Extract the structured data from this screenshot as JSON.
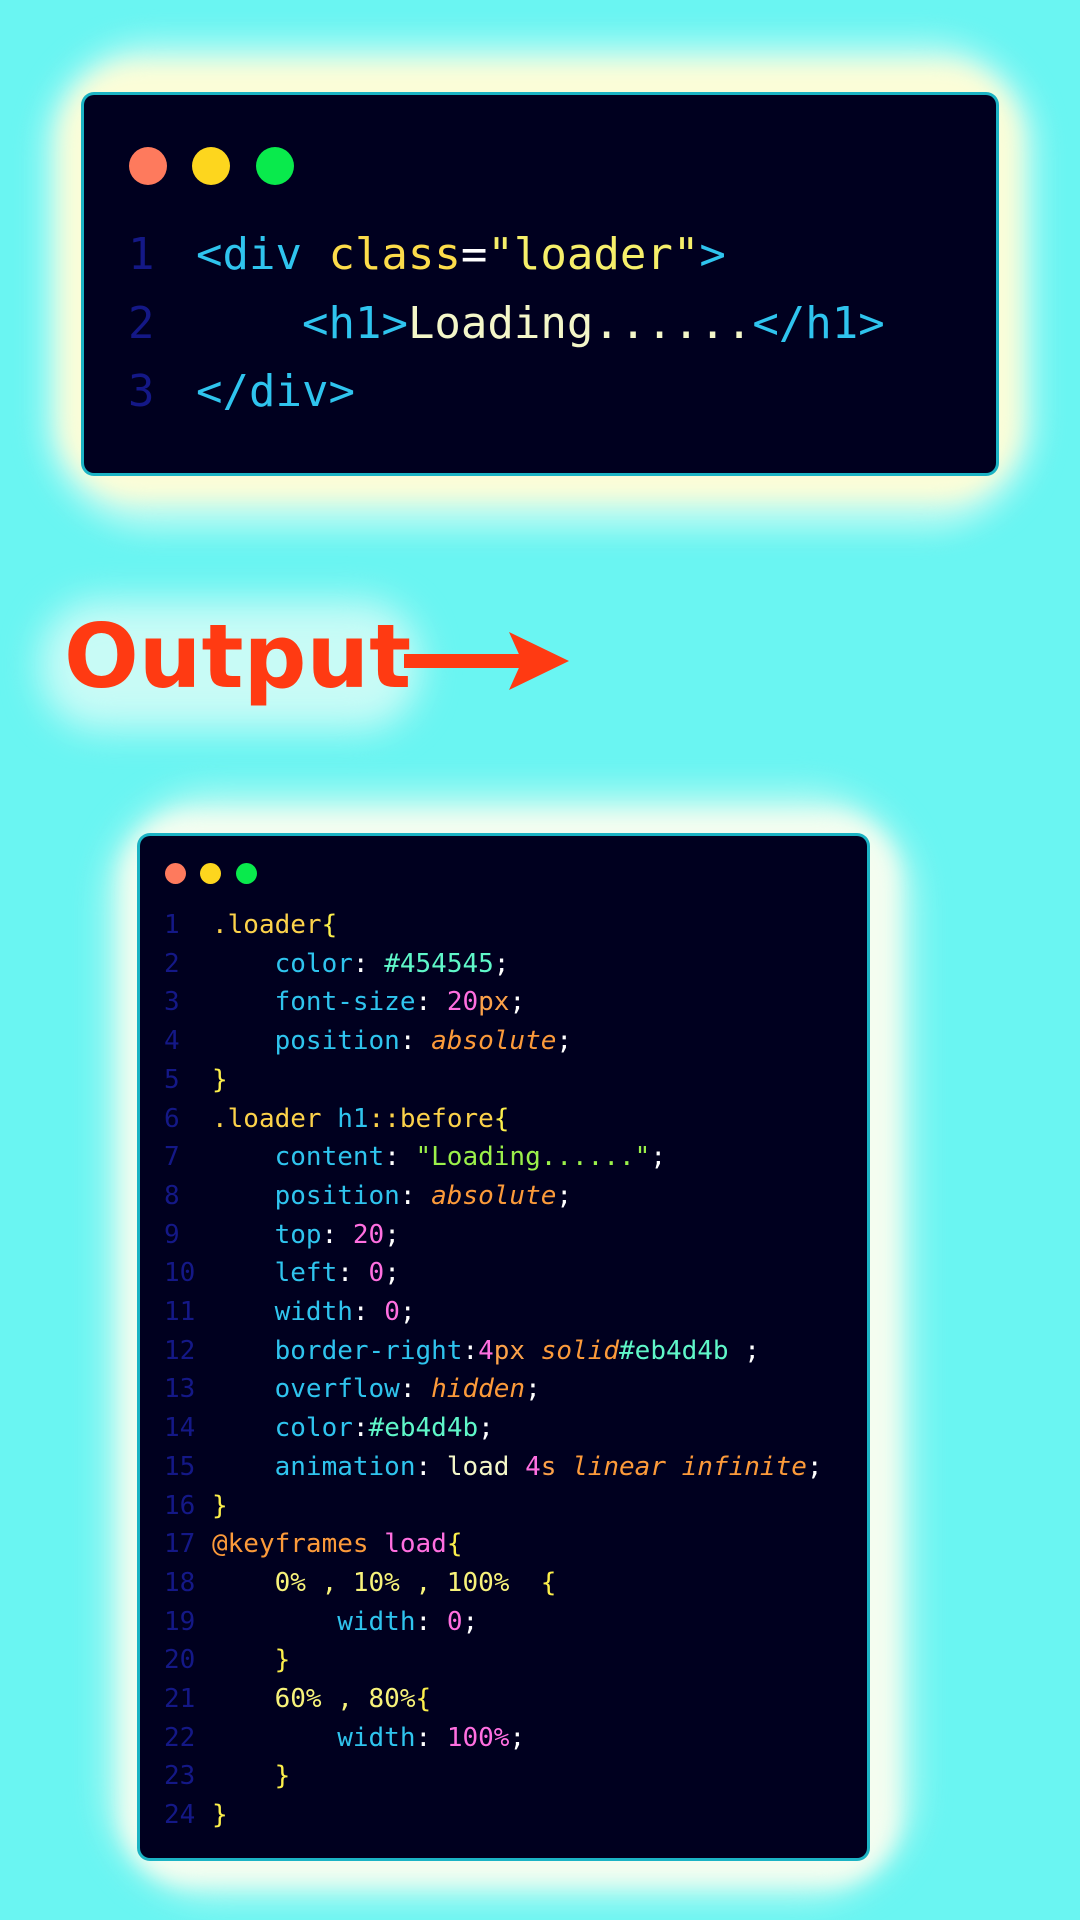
{
  "html_snippet": {
    "lines": [
      {
        "num": "1",
        "tokens": [
          {
            "t": "<div ",
            "c": "c-tag"
          },
          {
            "t": "class",
            "c": "c-attr"
          },
          {
            "t": "=",
            "c": "c-eq"
          },
          {
            "t": "\"loader\"",
            "c": "c-str"
          },
          {
            "t": ">",
            "c": "c-tag"
          }
        ]
      },
      {
        "num": "2",
        "tokens": [
          {
            "t": "    ",
            "c": "c-plain"
          },
          {
            "t": "<h1>",
            "c": "c-tag"
          },
          {
            "t": "Loading......",
            "c": "c-text"
          },
          {
            "t": "</h1>",
            "c": "c-tag"
          }
        ]
      },
      {
        "num": "3",
        "tokens": [
          {
            "t": "</div>",
            "c": "c-tag"
          }
        ]
      }
    ]
  },
  "output_label": "Output",
  "css_snippet": {
    "lines": [
      {
        "num": "1",
        "tokens": [
          {
            "t": ".loader",
            "c": "c-sel"
          },
          {
            "t": "{",
            "c": "c-brace"
          }
        ]
      },
      {
        "num": "2",
        "tokens": [
          {
            "t": "    color",
            "c": "c-prop"
          },
          {
            "t": ": ",
            "c": "c-punc"
          },
          {
            "t": "#454545",
            "c": "c-hex"
          },
          {
            "t": ";",
            "c": "c-punc"
          }
        ]
      },
      {
        "num": "3",
        "tokens": [
          {
            "t": "    font-size",
            "c": "c-prop"
          },
          {
            "t": ": ",
            "c": "c-punc"
          },
          {
            "t": "20",
            "c": "c-num"
          },
          {
            "t": "px",
            "c": "c-unit"
          },
          {
            "t": ";",
            "c": "c-punc"
          }
        ]
      },
      {
        "num": "4",
        "tokens": [
          {
            "t": "    position",
            "c": "c-prop"
          },
          {
            "t": ": ",
            "c": "c-punc"
          },
          {
            "t": "absolute",
            "c": "c-kw"
          },
          {
            "t": ";",
            "c": "c-punc"
          }
        ]
      },
      {
        "num": "5",
        "tokens": [
          {
            "t": "}",
            "c": "c-brace"
          }
        ]
      },
      {
        "num": "6",
        "tokens": [
          {
            "t": ".loader ",
            "c": "c-sel"
          },
          {
            "t": "h1",
            "c": "c-elem"
          },
          {
            "t": "::before",
            "c": "c-sel"
          },
          {
            "t": "{",
            "c": "c-brace"
          }
        ]
      },
      {
        "num": "7",
        "tokens": [
          {
            "t": "    content",
            "c": "c-prop"
          },
          {
            "t": ": ",
            "c": "c-punc"
          },
          {
            "t": "\"Loading......\"",
            "c": "c-cstr"
          },
          {
            "t": ";",
            "c": "c-punc"
          }
        ]
      },
      {
        "num": "8",
        "tokens": [
          {
            "t": "    position",
            "c": "c-prop"
          },
          {
            "t": ": ",
            "c": "c-punc"
          },
          {
            "t": "absolute",
            "c": "c-kw"
          },
          {
            "t": ";",
            "c": "c-punc"
          }
        ]
      },
      {
        "num": "9",
        "tokens": [
          {
            "t": "    top",
            "c": "c-prop"
          },
          {
            "t": ": ",
            "c": "c-punc"
          },
          {
            "t": "20",
            "c": "c-num"
          },
          {
            "t": ";",
            "c": "c-punc"
          }
        ]
      },
      {
        "num": "10",
        "tokens": [
          {
            "t": "    left",
            "c": "c-prop"
          },
          {
            "t": ": ",
            "c": "c-punc"
          },
          {
            "t": "0",
            "c": "c-num"
          },
          {
            "t": ";",
            "c": "c-punc"
          }
        ]
      },
      {
        "num": "11",
        "tokens": [
          {
            "t": "    width",
            "c": "c-prop"
          },
          {
            "t": ": ",
            "c": "c-punc"
          },
          {
            "t": "0",
            "c": "c-num"
          },
          {
            "t": ";",
            "c": "c-punc"
          }
        ]
      },
      {
        "num": "12",
        "tokens": [
          {
            "t": "    border-right",
            "c": "c-prop"
          },
          {
            "t": ":",
            "c": "c-punc"
          },
          {
            "t": "4",
            "c": "c-num"
          },
          {
            "t": "px ",
            "c": "c-unit"
          },
          {
            "t": "solid",
            "c": "c-kw"
          },
          {
            "t": "#eb4d4b",
            "c": "c-hex"
          },
          {
            "t": " ;",
            "c": "c-punc"
          }
        ]
      },
      {
        "num": "13",
        "tokens": [
          {
            "t": "    overflow",
            "c": "c-prop"
          },
          {
            "t": ": ",
            "c": "c-punc"
          },
          {
            "t": "hidden",
            "c": "c-kw"
          },
          {
            "t": ";",
            "c": "c-punc"
          }
        ]
      },
      {
        "num": "14",
        "tokens": [
          {
            "t": "    color",
            "c": "c-prop"
          },
          {
            "t": ":",
            "c": "c-punc"
          },
          {
            "t": "#eb4d4b",
            "c": "c-hex"
          },
          {
            "t": ";",
            "c": "c-punc"
          }
        ]
      },
      {
        "num": "15",
        "tokens": [
          {
            "t": "    animation",
            "c": "c-prop"
          },
          {
            "t": ": ",
            "c": "c-punc"
          },
          {
            "t": "load ",
            "c": "c-plain"
          },
          {
            "t": "4",
            "c": "c-num"
          },
          {
            "t": "s ",
            "c": "c-unit"
          },
          {
            "t": "linear infinite",
            "c": "c-kw"
          },
          {
            "t": ";",
            "c": "c-punc"
          }
        ]
      },
      {
        "num": "16",
        "tokens": [
          {
            "t": "}",
            "c": "c-brace"
          }
        ]
      },
      {
        "num": "17",
        "tokens": [
          {
            "t": "@keyframes ",
            "c": "c-at"
          },
          {
            "t": "load",
            "c": "c-name"
          },
          {
            "t": "{",
            "c": "c-brace"
          }
        ]
      },
      {
        "num": "18",
        "tokens": [
          {
            "t": "    0% , 10% , 100%  ",
            "c": "c-pct"
          },
          {
            "t": "{",
            "c": "c-brace"
          }
        ]
      },
      {
        "num": "19",
        "tokens": [
          {
            "t": "        width",
            "c": "c-prop"
          },
          {
            "t": ": ",
            "c": "c-punc"
          },
          {
            "t": "0",
            "c": "c-num"
          },
          {
            "t": ";",
            "c": "c-punc"
          }
        ]
      },
      {
        "num": "20",
        "tokens": [
          {
            "t": "    }",
            "c": "c-brace"
          }
        ]
      },
      {
        "num": "21",
        "tokens": [
          {
            "t": "    60% , 80%",
            "c": "c-pct"
          },
          {
            "t": "{",
            "c": "c-brace"
          }
        ]
      },
      {
        "num": "22",
        "tokens": [
          {
            "t": "        width",
            "c": "c-prop"
          },
          {
            "t": ": ",
            "c": "c-punc"
          },
          {
            "t": "100%",
            "c": "c-num"
          },
          {
            "t": ";",
            "c": "c-punc"
          }
        ]
      },
      {
        "num": "23",
        "tokens": [
          {
            "t": "    }",
            "c": "c-brace"
          }
        ]
      },
      {
        "num": "24",
        "tokens": [
          {
            "t": "}",
            "c": "c-brace"
          }
        ]
      }
    ]
  },
  "window_controls": [
    {
      "name": "close-dot",
      "color": "#fe7a5d"
    },
    {
      "name": "minimize-dot",
      "color": "#fdd61e"
    },
    {
      "name": "maximize-dot",
      "color": "#09ea4c"
    }
  ],
  "accent_color": "#ff3a12",
  "background_color": "#6af5f2"
}
